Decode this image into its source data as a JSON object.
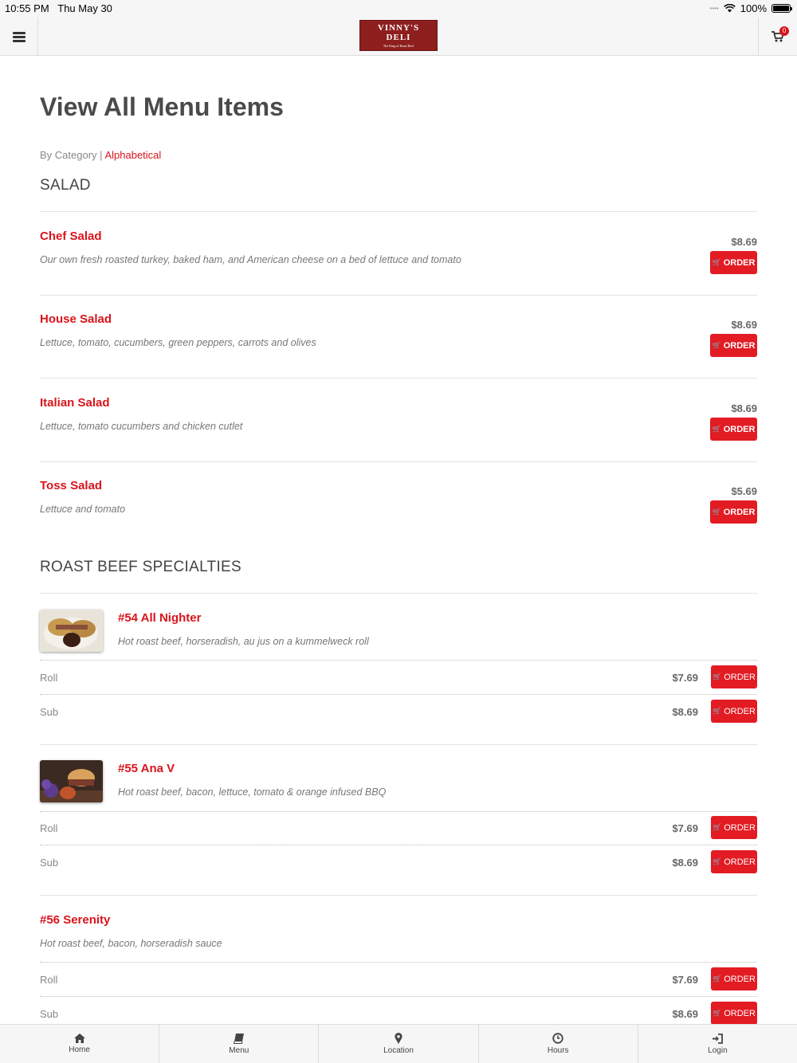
{
  "status": {
    "time": "10:55 PM",
    "date": "Thu May 30",
    "battery": "100%"
  },
  "header": {
    "logo_line1": "VINNY'S",
    "logo_line2": "DELI",
    "logo_tagline": "The King of Roast Beef",
    "cart_count": "0"
  },
  "page": {
    "title": "View All Menu Items",
    "view_by_category": "By Category",
    "separator": "|",
    "view_alphabetical": "Alphabetical"
  },
  "order_label": "ORDER",
  "categories": [
    {
      "name": "SALAD",
      "items": [
        {
          "name": "Chef Salad",
          "desc": "Our own fresh roasted turkey, baked ham, and American cheese on a bed of lettuce and tomato",
          "price": "$8.69"
        },
        {
          "name": "House Salad",
          "desc": "Lettuce, tomato, cucumbers, green peppers, carrots and olives",
          "price": "$8.69"
        },
        {
          "name": "Italian Salad",
          "desc": "Lettuce, tomato cucumbers and chicken cutlet",
          "price": "$8.69"
        },
        {
          "name": "Toss Salad",
          "desc": "Lettuce and tomato",
          "price": "$5.69"
        }
      ]
    },
    {
      "name": "ROAST BEEF SPECIALTIES",
      "items": [
        {
          "name": "#54 All Nighter",
          "desc": "Hot roast beef, horseradish, au jus on a kummelweck roll",
          "sizes": [
            {
              "size": "Roll",
              "price": "$7.69"
            },
            {
              "size": "Sub",
              "price": "$8.69"
            }
          ]
        },
        {
          "name": "#55 Ana V",
          "desc": "Hot roast beef, bacon, lettuce, tomato & orange infused BBQ",
          "sizes": [
            {
              "size": "Roll",
              "price": "$7.69"
            },
            {
              "size": "Sub",
              "price": "$8.69"
            }
          ]
        },
        {
          "name": "#56 Serenity",
          "desc": "Hot roast beef, bacon, horseradish sauce",
          "sizes": [
            {
              "size": "Roll",
              "price": "$7.69"
            },
            {
              "size": "Sub",
              "price": "$8.69"
            }
          ]
        }
      ]
    }
  ],
  "tabs": [
    {
      "label": "Home",
      "icon": "home-icon"
    },
    {
      "label": "Menu",
      "icon": "book-icon"
    },
    {
      "label": "Location",
      "icon": "map-marker-icon"
    },
    {
      "label": "Hours",
      "icon": "clock-icon"
    },
    {
      "label": "Login",
      "icon": "sign-in-icon"
    }
  ],
  "colors": {
    "accent": "#e31b23",
    "brand": "#8e1f1f"
  }
}
